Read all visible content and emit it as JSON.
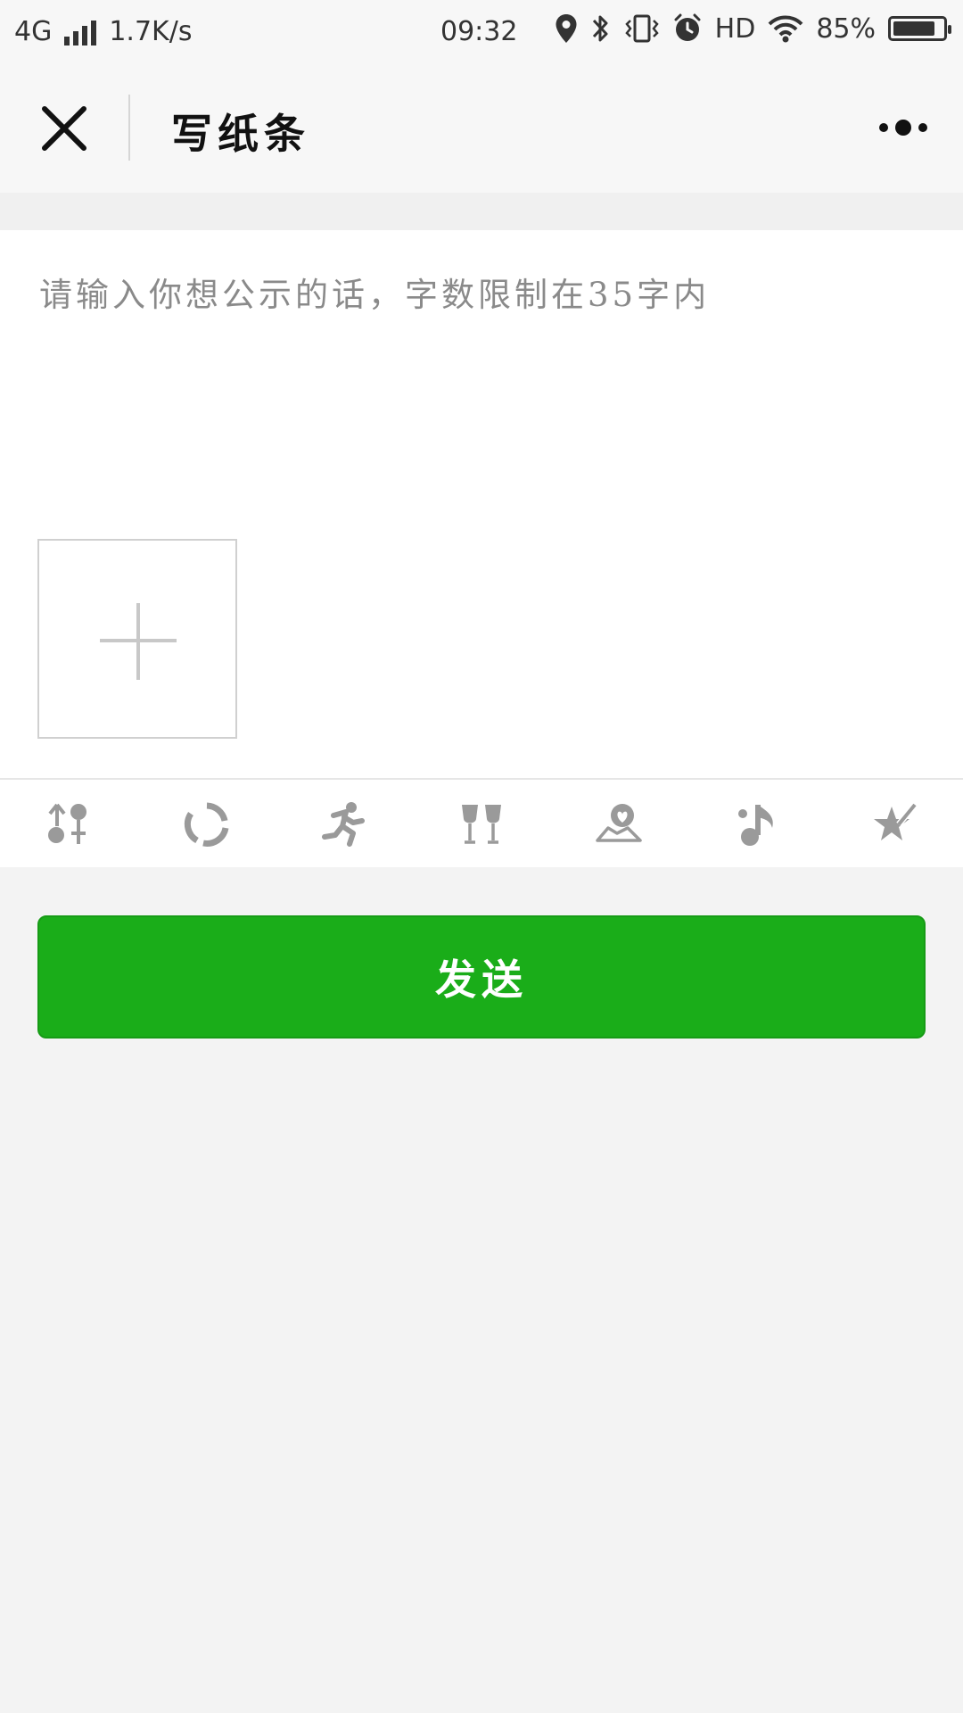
{
  "status_bar": {
    "network": "4G",
    "speed": "1.7K/s",
    "time": "09:32",
    "hd": "HD",
    "battery_percent": "85%",
    "battery_level": 0.85,
    "icons": [
      "signal-icon",
      "location-icon",
      "bluetooth-icon",
      "vibrate-icon",
      "alarm-icon",
      "wifi-icon",
      "battery-icon"
    ]
  },
  "nav": {
    "title": "写纸条",
    "close_icon": "close-icon",
    "more_icon": "more-icon"
  },
  "editor": {
    "placeholder": "请输入你想公示的话，字数限制在35字内",
    "value": "",
    "add_image_icon": "plus-icon"
  },
  "toolbar": {
    "items": [
      "gender-icon",
      "refresh-icon",
      "running-icon",
      "wine-glasses-icon",
      "map-heart-icon",
      "music-note-icon",
      "star-pencil-icon"
    ]
  },
  "send_button": {
    "label": "发送"
  },
  "colors": {
    "accent": "#1aad19",
    "icon_gray": "#9a9a9a",
    "background": "#f3f3f3"
  }
}
